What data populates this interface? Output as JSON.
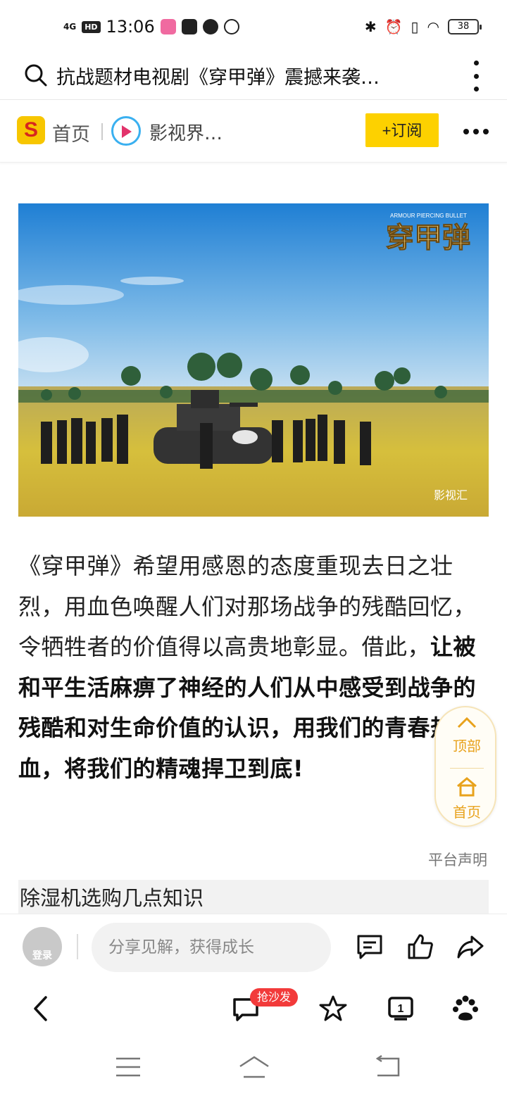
{
  "status_bar": {
    "network": "4G",
    "hd": "HD",
    "time": "13:06",
    "battery": "38"
  },
  "search_bar": {
    "title": "抗战题材电视剧《穿甲弹》震撼来袭…"
  },
  "nav_bar": {
    "logo_letter": "S",
    "home_label": "首页",
    "channel_name": "影视界…",
    "subscribe_label": "+订阅"
  },
  "photo": {
    "title_overlay": "穿甲弹",
    "subtitle_overlay": "ARMOUR PIERCING BULLET",
    "watermark": "影视汇"
  },
  "article": {
    "para_normal": "《穿甲弹》希望用感恩的态度重现去日之壮烈，用血色唤醒人们对那场战争的残酷回忆，令牺牲者的价值得以高贵地彰显。借此，",
    "para_bold": "让被和平生活麻痹了神经的人们从中感受到战争的残酷和对生命价值的认识，用我们的青春热血，将我们的精魂捍卫到底!",
    "disclaimer": "平台声明",
    "related_title": "除湿机选购几点知识"
  },
  "floating": {
    "top_label": "顶部",
    "home_label": "首页"
  },
  "comment_bar": {
    "avatar_label": "登录",
    "placeholder": "分享见解，获得成长"
  },
  "browser_bar": {
    "comment_badge": "抢沙发",
    "tab_count": "1"
  },
  "icons": [
    "search-icon",
    "more-vertical-icon",
    "more-horizontal-icon",
    "comment-list-icon",
    "thumb-up-icon",
    "share-icon",
    "back-icon",
    "comment-icon",
    "star-icon",
    "tabs-icon",
    "baidu-paw-icon",
    "menu-icon",
    "home-icon",
    "return-icon"
  ],
  "colors": {
    "accent_yellow": "#fdd100",
    "float_orange": "#e8a21c",
    "badge_red": "#f23a3a"
  }
}
